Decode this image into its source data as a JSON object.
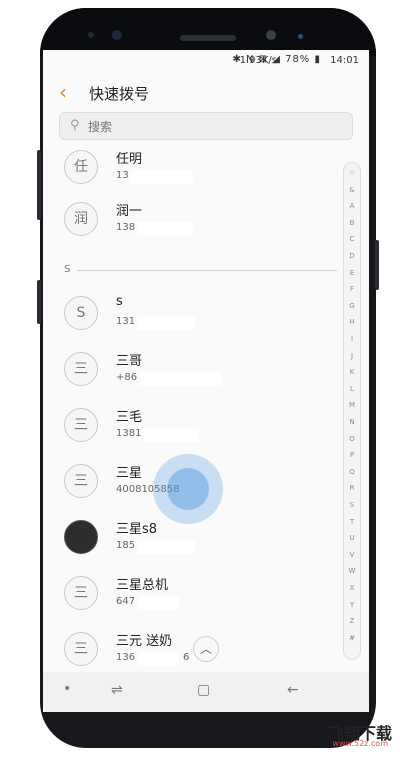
{
  "status_bar": {
    "network_speed": "1.93K/s",
    "icons": "✱ N ⊠ ◢ 78% ▮",
    "time": "14:01"
  },
  "header": {
    "title": "快速拨号"
  },
  "search": {
    "placeholder": "搜索"
  },
  "section": {
    "label": "S"
  },
  "contacts": [
    {
      "avatar": "任",
      "name": "任明",
      "number": "13"
    },
    {
      "avatar": "润",
      "name": "润一",
      "number": "138"
    },
    {
      "avatar": "S",
      "name": "s",
      "number": "131"
    },
    {
      "avatar": "三",
      "name": "三哥",
      "number": "+86"
    },
    {
      "avatar": "三",
      "name": "三毛",
      "number": "1381"
    },
    {
      "avatar": "三",
      "name": "三星",
      "number": "4008105858"
    },
    {
      "avatar": "",
      "name": "三星s8",
      "number": "185"
    },
    {
      "avatar": "三",
      "name": "三星总机",
      "number": "647"
    },
    {
      "avatar": "三",
      "name": "三元 送奶",
      "number": "136"
    }
  ],
  "contact_extra": {
    "last_digit": "6"
  },
  "index_bar": [
    "☆",
    "&",
    "A",
    "B",
    "C",
    "D",
    "E",
    "F",
    "G",
    "H",
    "I",
    "J",
    "K",
    "L",
    "M",
    "N",
    "O",
    "P",
    "Q",
    "R",
    "S",
    "T",
    "U",
    "V",
    "W",
    "X",
    "Y",
    "Z",
    "#"
  ],
  "nav": {
    "dot": "•",
    "recent": "⇌",
    "home": "▢",
    "back": "←"
  },
  "icons": {
    "back": "chevron-left-icon",
    "search": "magnifier-icon",
    "scroll_top": "chevron-up-icon"
  },
  "colors": {
    "accent": "#e3892a",
    "touch": "#5aa0e6"
  },
  "watermark": {
    "main": "飞翔下载",
    "sub": "www.52z.com"
  }
}
